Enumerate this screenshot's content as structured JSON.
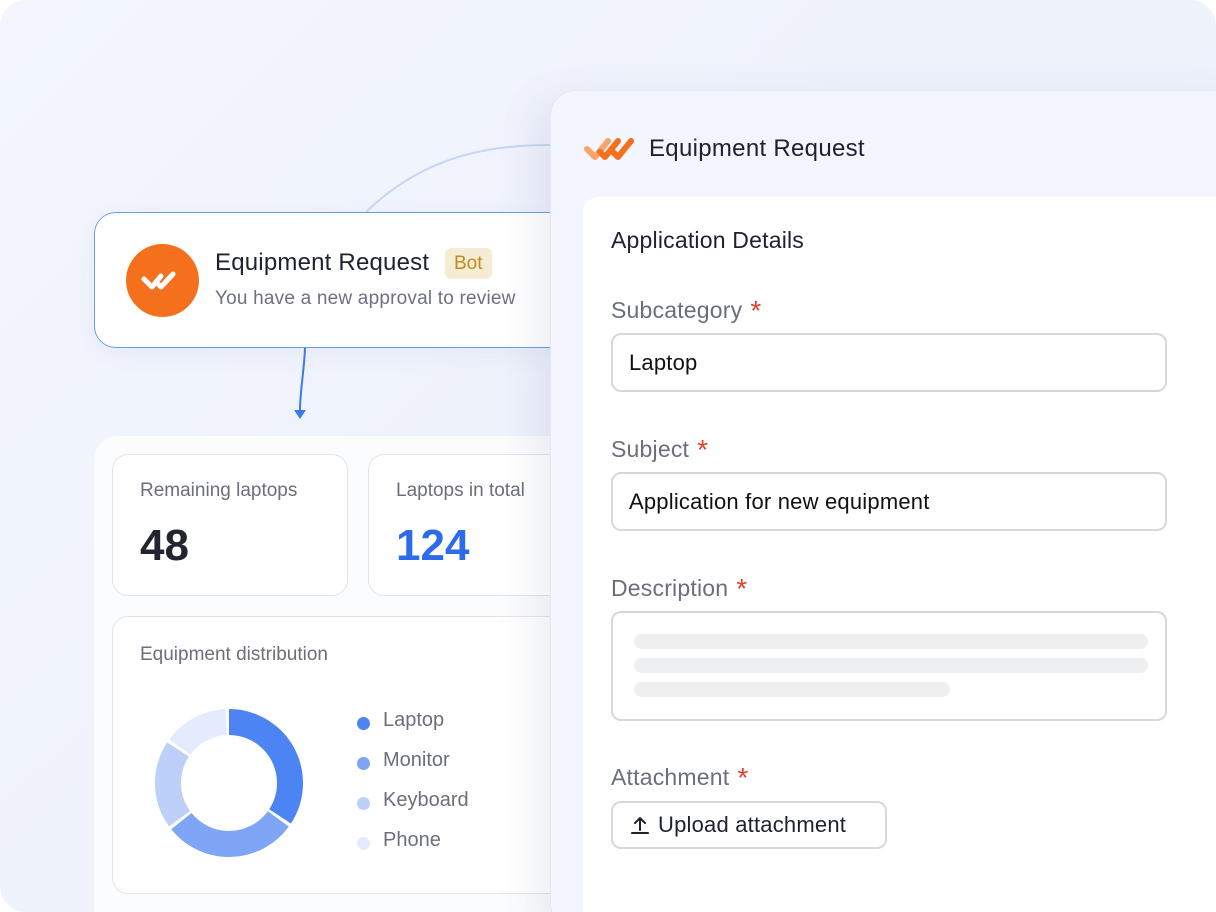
{
  "notification": {
    "title": "Equipment Request",
    "badge": "Bot",
    "message": "You have a new approval to review"
  },
  "dashboard": {
    "stats": [
      {
        "label": "Remaining laptops",
        "value": "48",
        "color": "#222530"
      },
      {
        "label": "Laptops in total",
        "value": "124",
        "color": "#2e6bea"
      }
    ],
    "distribution": {
      "title": "Equipment distribution",
      "legend": [
        {
          "label": "Laptop",
          "color": "#4d84f3"
        },
        {
          "label": "Monitor",
          "color": "#7fa6f6"
        },
        {
          "label": "Keyboard",
          "color": "#bcd0fa"
        },
        {
          "label": "Phone",
          "color": "#e3ebfd"
        }
      ]
    }
  },
  "chart_data": {
    "type": "pie",
    "title": "Equipment distribution",
    "categories": [
      "Laptop",
      "Monitor",
      "Keyboard",
      "Phone"
    ],
    "values": [
      35,
      30,
      20,
      15
    ],
    "donut": true,
    "legend": "right"
  },
  "form": {
    "title": "Equipment Request",
    "section_title": "Application Details",
    "fields": {
      "subcategory": {
        "label": "Subcategory",
        "value": "Laptop",
        "required": "*"
      },
      "subject": {
        "label": "Subject",
        "value": "Application for new equipment",
        "required": "*"
      },
      "description": {
        "label": "Description",
        "value": "",
        "required": "*"
      },
      "attachment": {
        "label": "Attachment",
        "required": "*"
      }
    },
    "upload_label": "Upload attachment"
  },
  "colors": {
    "brand_orange": "#f4701d",
    "accent_blue": "#2e6bea",
    "required_red": "#e0412a"
  },
  "icons": [
    "brand-logo-icon",
    "check-marks-icon",
    "upload-icon"
  ]
}
